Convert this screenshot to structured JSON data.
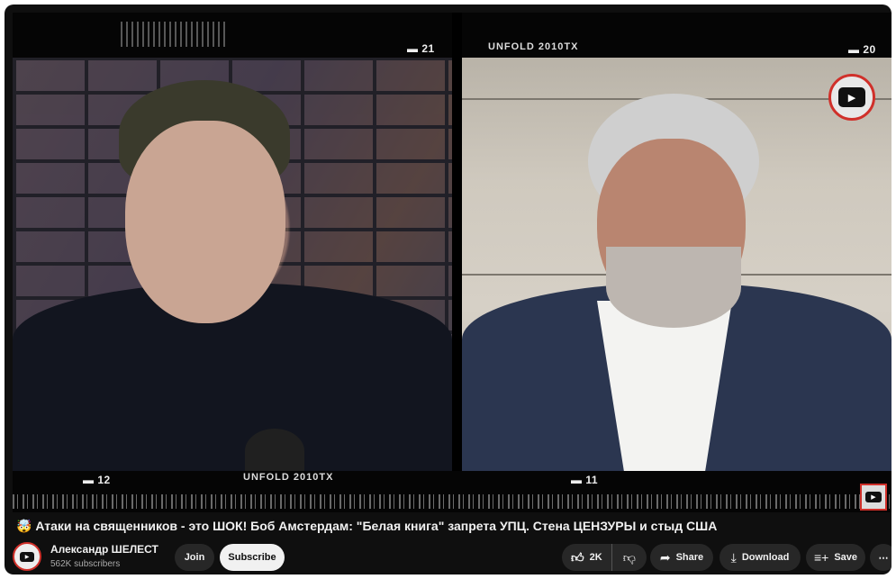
{
  "video": {
    "top_left_counter": "▬ 21",
    "top_right_counter": "▬ 20",
    "top_brand": "UNFOLD 2010TX",
    "bottom_left_counter": "▬ 12",
    "bottom_brand": "UNFOLD 2010TX",
    "bottom_mid_counter": "▬ 11",
    "badge_icon": "youtube-play-icon"
  },
  "title": "🤯 Атаки на священников - это ШОК! Боб Амстердам: \"Белая книга\" запрета УПЦ. Стена ЦЕНЗУРЫ и стыд США",
  "channel": {
    "name": "Александр ШЕЛЕСТ",
    "subscribers": "562K subscribers",
    "join_label": "Join",
    "subscribe_label": "Subscribe"
  },
  "actions": {
    "like_count": "2K",
    "share_label": "Share",
    "download_label": "Download",
    "save_label": "Save",
    "more_label": "⋯"
  },
  "icons": [
    "youtube-play-icon",
    "thumbs-up-icon",
    "thumbs-down-icon",
    "share-icon",
    "download-icon",
    "save-playlist-icon",
    "more-icon"
  ],
  "colors": {
    "background": "#0f0f0f",
    "accent": "#d0302a",
    "text": "#f1f1f1",
    "secondary_text": "#aaaaaa"
  }
}
